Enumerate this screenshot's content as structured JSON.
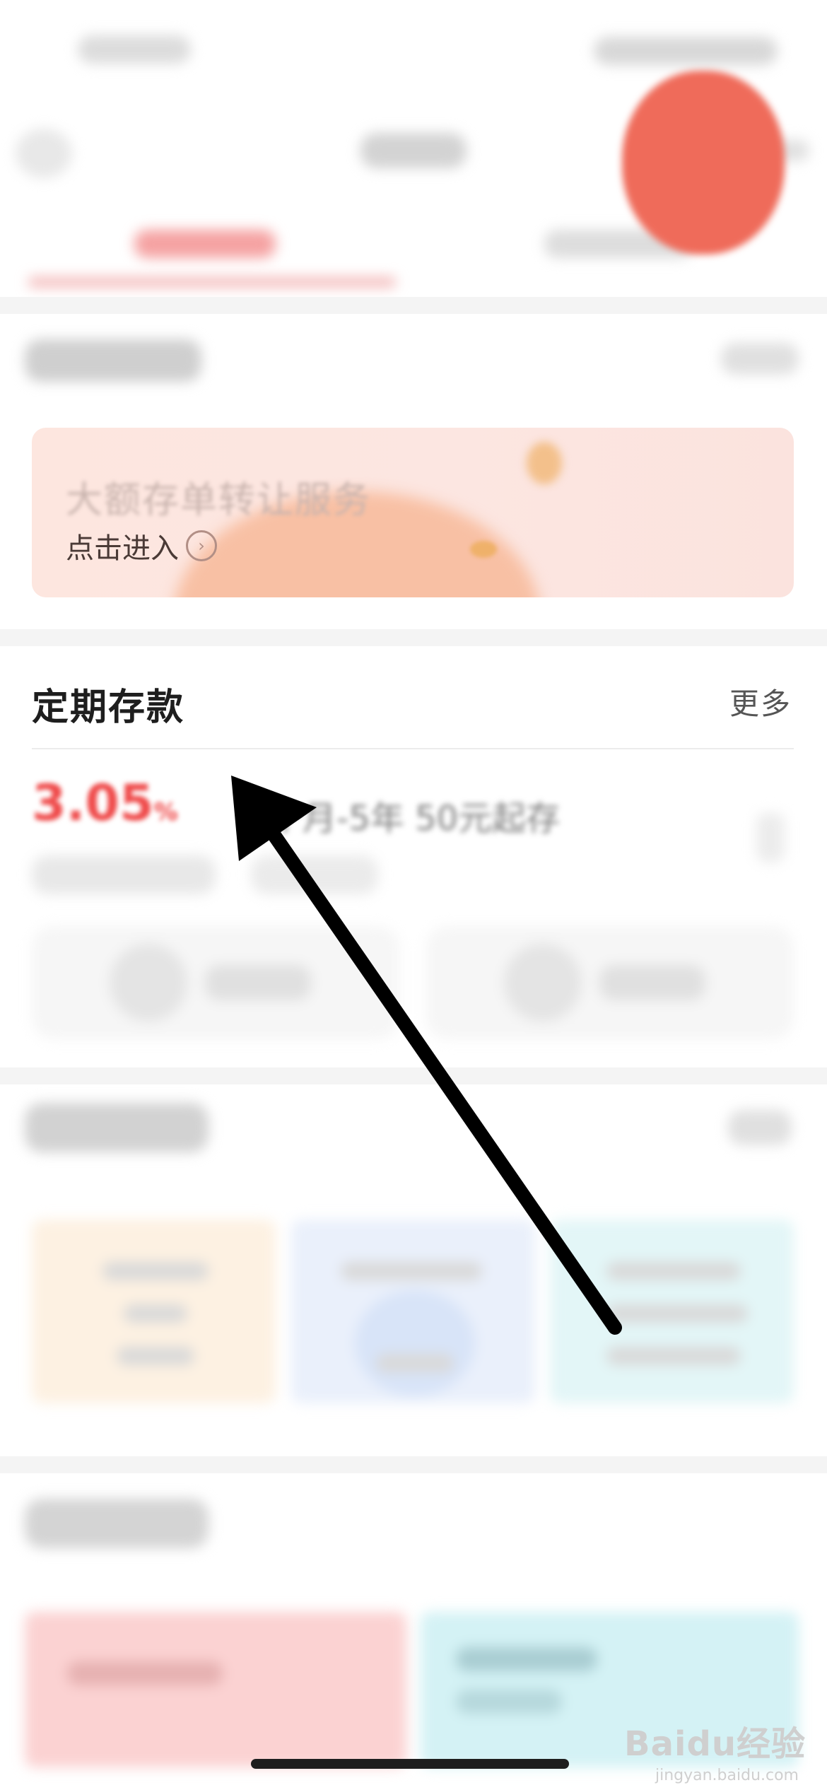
{
  "banner": {
    "title": "大额存单转让服务",
    "sub_label": "点击进入",
    "enter_icon": "chevron-right-circle-icon"
  },
  "fixed_deposit": {
    "title": "定期存款",
    "more_label": "更多",
    "rate_value": "3.05",
    "rate_unit": "%",
    "rate_desc": "个月-5年  50元起存"
  },
  "watermark": {
    "text": "Baidu经验",
    "sub": "jingyan.baidu.com"
  },
  "colors": {
    "accent_red": "#ef4b4b",
    "arrow": "#000000"
  }
}
